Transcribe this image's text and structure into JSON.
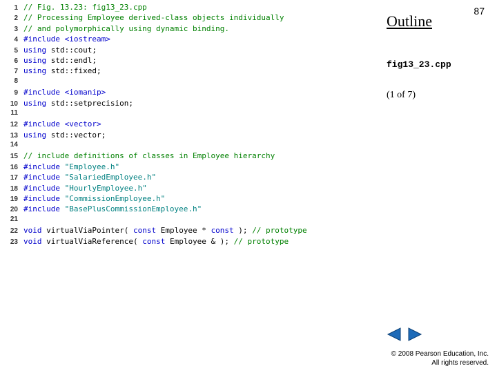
{
  "slide_number": "87",
  "outline": "Outline",
  "file": "fig13_23.cpp",
  "page_of": "(1 of 7)",
  "copyright": "© 2008 Pearson Education, Inc.  All rights reserved.",
  "code": [
    {
      "n": "1",
      "t": [
        {
          "c": "comm",
          "s": "// Fig. 13.23: fig13_23.cpp"
        }
      ]
    },
    {
      "n": "2",
      "t": [
        {
          "c": "comm",
          "s": "// Processing Employee derived-class objects individually"
        }
      ]
    },
    {
      "n": "3",
      "t": [
        {
          "c": "comm",
          "s": "// and polymorphically using dynamic binding."
        }
      ]
    },
    {
      "n": "4",
      "t": [
        {
          "c": "prepro",
          "s": "#include "
        },
        {
          "c": "inc",
          "s": "<iostream>"
        }
      ]
    },
    {
      "n": "5",
      "t": [
        {
          "c": "kw",
          "s": "using"
        },
        {
          "c": "norm",
          "s": " std::cout;"
        }
      ]
    },
    {
      "n": "6",
      "t": [
        {
          "c": "kw",
          "s": "using"
        },
        {
          "c": "norm",
          "s": " std::endl;"
        }
      ]
    },
    {
      "n": "7",
      "t": [
        {
          "c": "kw",
          "s": "using"
        },
        {
          "c": "norm",
          "s": " std::fixed;"
        }
      ]
    },
    {
      "n": "8",
      "t": []
    },
    {
      "n": "9",
      "t": [
        {
          "c": "prepro",
          "s": "#include "
        },
        {
          "c": "inc",
          "s": "<iomanip>"
        }
      ]
    },
    {
      "n": "10",
      "t": [
        {
          "c": "kw",
          "s": "using"
        },
        {
          "c": "norm",
          "s": " std::setprecision;"
        }
      ]
    },
    {
      "n": "11",
      "t": []
    },
    {
      "n": "12",
      "t": [
        {
          "c": "prepro",
          "s": "#include "
        },
        {
          "c": "inc",
          "s": "<vector>"
        }
      ]
    },
    {
      "n": "13",
      "t": [
        {
          "c": "kw",
          "s": "using"
        },
        {
          "c": "norm",
          "s": " std::vector;"
        }
      ]
    },
    {
      "n": "14",
      "t": []
    },
    {
      "n": "15",
      "t": [
        {
          "c": "comm",
          "s": "// include definitions of classes in Employee hierarchy"
        }
      ]
    },
    {
      "n": "16",
      "t": [
        {
          "c": "prepro",
          "s": "#include "
        },
        {
          "c": "str",
          "s": "\"Employee.h\""
        }
      ]
    },
    {
      "n": "17",
      "t": [
        {
          "c": "prepro",
          "s": "#include "
        },
        {
          "c": "str",
          "s": "\"SalariedEmployee.h\""
        }
      ]
    },
    {
      "n": "18",
      "t": [
        {
          "c": "prepro",
          "s": "#include "
        },
        {
          "c": "str",
          "s": "\"HourlyEmployee.h\""
        }
      ]
    },
    {
      "n": "19",
      "t": [
        {
          "c": "prepro",
          "s": "#include "
        },
        {
          "c": "str",
          "s": "\"CommissionEmployee.h\""
        }
      ]
    },
    {
      "n": "20",
      "t": [
        {
          "c": "prepro",
          "s": "#include "
        },
        {
          "c": "str",
          "s": "\"BasePlusCommissionEmployee.h\""
        }
      ]
    },
    {
      "n": "21",
      "t": []
    },
    {
      "n": "22",
      "t": [
        {
          "c": "kw",
          "s": "void"
        },
        {
          "c": "norm",
          "s": " virtualViaPointer( "
        },
        {
          "c": "kw",
          "s": "const"
        },
        {
          "c": "norm",
          "s": " Employee * "
        },
        {
          "c": "kw",
          "s": "const"
        },
        {
          "c": "norm",
          "s": " ); "
        },
        {
          "c": "comm",
          "s": "// prototype"
        }
      ]
    },
    {
      "n": "23",
      "t": [
        {
          "c": "kw",
          "s": "void"
        },
        {
          "c": "norm",
          "s": " virtualViaReference( "
        },
        {
          "c": "kw",
          "s": "const"
        },
        {
          "c": "norm",
          "s": " Employee & ); "
        },
        {
          "c": "comm",
          "s": "// prototype"
        }
      ]
    }
  ]
}
